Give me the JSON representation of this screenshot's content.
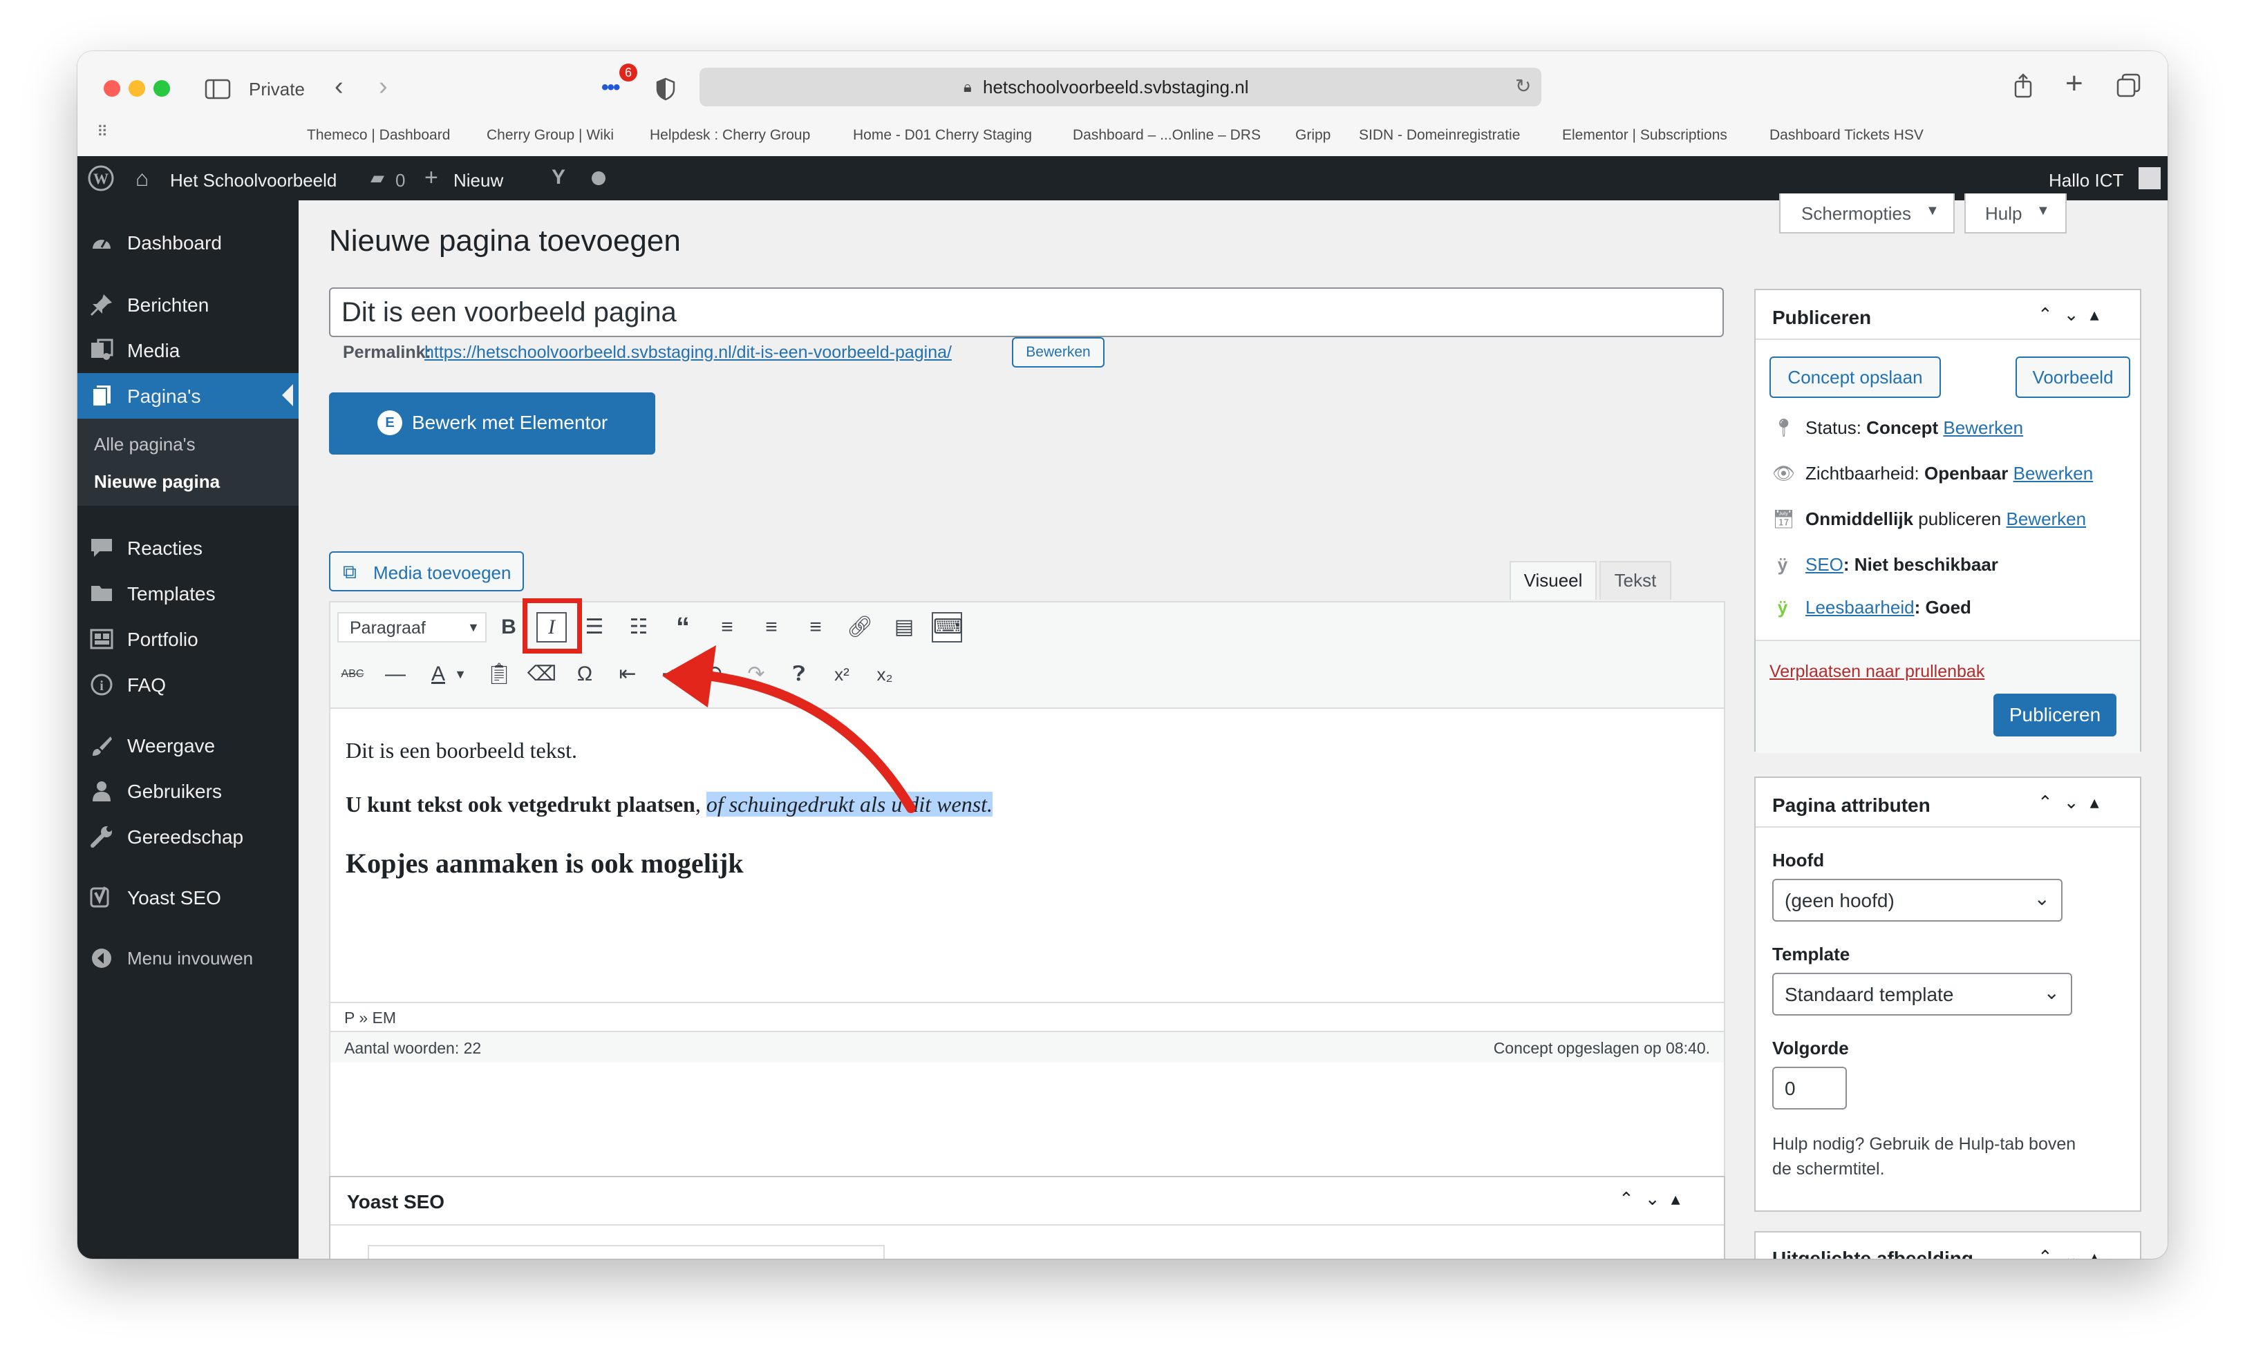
{
  "browser": {
    "private_label": "Private",
    "tracker_badge": "6",
    "url": "hetschoolvoorbeeld.svbstaging.nl",
    "bookmarks": [
      "Themeco | Dashboard",
      "Cherry Group | Wiki",
      "Helpdesk : Cherry Group",
      "Home - D01 Cherry Staging",
      "Dashboard – ...Online – DRS",
      "Gripp",
      "SIDN - Domeinregistratie",
      "Elementor | Subscriptions",
      "Dashboard Tickets HSV"
    ]
  },
  "adminbar": {
    "site_name": "Het Schoolvoorbeeld",
    "comments_count": "0",
    "new_label": "Nieuw",
    "greeting": "Hallo ICT"
  },
  "sidebar": {
    "items": [
      {
        "label": "Dashboard",
        "icon": "dashboard-icon"
      },
      {
        "label": "Berichten",
        "icon": "pin-icon"
      },
      {
        "label": "Media",
        "icon": "media-icon"
      },
      {
        "label": "Pagina's",
        "icon": "pages-icon"
      },
      {
        "label": "Reacties",
        "icon": "comment-icon"
      },
      {
        "label": "Templates",
        "icon": "folder-icon"
      },
      {
        "label": "Portfolio",
        "icon": "portfolio-icon"
      },
      {
        "label": "FAQ",
        "icon": "info-icon"
      },
      {
        "label": "Weergave",
        "icon": "brush-icon"
      },
      {
        "label": "Gebruikers",
        "icon": "user-icon"
      },
      {
        "label": "Gereedschap",
        "icon": "wrench-icon"
      },
      {
        "label": "Yoast SEO",
        "icon": "yoast-icon"
      },
      {
        "label": "Menu invouwen",
        "icon": "collapse-icon"
      }
    ],
    "submenu": [
      "Alle pagina's",
      "Nieuwe pagina"
    ]
  },
  "screen_options": {
    "screen_label": "Schermopties",
    "help_label": "Hulp"
  },
  "page": {
    "heading": "Nieuwe pagina toevoegen",
    "title_value": "Dit is een voorbeeld pagina",
    "permalink_label": "Permalink:",
    "permalink_url": "https://hetschoolvoorbeeld.svbstaging.nl/dit-is-een-voorbeeld-pagina/",
    "permalink_edit": "Bewerken",
    "elementor_label": "Bewerk met Elementor",
    "media_label": "Media toevoegen"
  },
  "editor": {
    "tab_visual": "Visueel",
    "tab_text": "Tekst",
    "format_select": "Paragraaf",
    "line1": "Dit is een boorbeeld tekst.",
    "line2_bold": "U kunt tekst ook vetgedrukt plaatsen",
    "line2_sep": ", ",
    "line2_italic": "of schuingedrukt als u dit wenst.",
    "heading": "Kopjes aanmaken is ook mogelijk",
    "path": "P » EM",
    "word_count": "Aantal woorden: 22",
    "saved_status": "Concept opgeslagen op 08:40."
  },
  "yoast_box": {
    "title": "Yoast SEO"
  },
  "publish": {
    "title": "Publiceren",
    "save_draft": "Concept opslaan",
    "preview": "Voorbeeld",
    "status_label": "Status:",
    "status_value": "Concept",
    "visibility_label": "Zichtbaarheid:",
    "visibility_value": "Openbaar",
    "schedule_bold": "Onmiddellijk",
    "schedule_rest": "publiceren",
    "edit_link": "Bewerken",
    "seo_link": "SEO",
    "seo_value": ": Niet beschikbaar",
    "readability_link": "Leesbaarheid",
    "readability_value": ": Goed",
    "trash": "Verplaatsen naar prullenbak",
    "publish_button": "Publiceren"
  },
  "attributes": {
    "title": "Pagina attributen",
    "parent_label": "Hoofd",
    "parent_value": "(geen hoofd)",
    "template_label": "Template",
    "template_value": "Standaard template",
    "order_label": "Volgorde",
    "order_value": "0",
    "help_text_1": "Hulp nodig? Gebruik de Hulp-tab boven",
    "help_text_2": "de schermtitel."
  },
  "featured_box": {
    "title": "Uitgelichte afbeelding"
  },
  "colors": {
    "wp_blue": "#2271b1",
    "admin_dark": "#1d2327",
    "highlight_red": "#e2261b",
    "selection": "#b4d5fe"
  }
}
